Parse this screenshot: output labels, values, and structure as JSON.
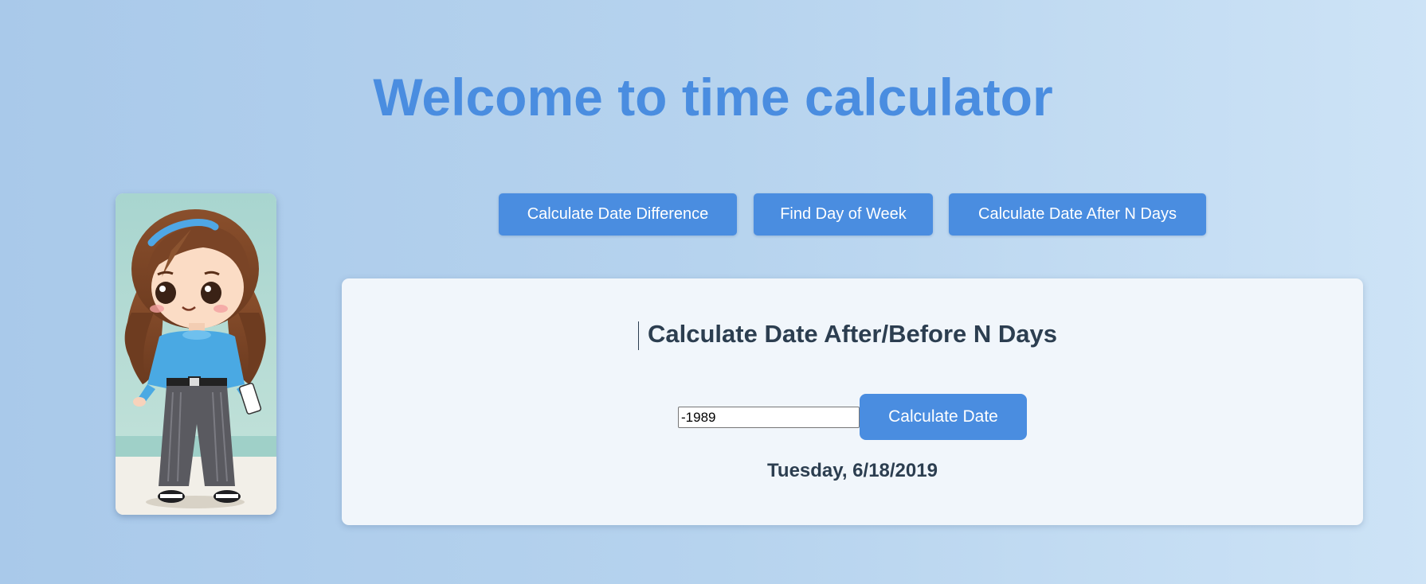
{
  "page": {
    "title": "Welcome to time calculator"
  },
  "nav": {
    "buttons": [
      {
        "label": "Calculate Date Difference"
      },
      {
        "label": "Find Day of Week"
      },
      {
        "label": "Calculate Date After N Days"
      }
    ]
  },
  "panel": {
    "title": "Calculate Date After/Before N Days",
    "days_input_value": "-1989",
    "calculate_button_label": "Calculate Date",
    "result": "Tuesday, 6/18/2019"
  },
  "colors": {
    "accent": "#4a8de0",
    "heading_text": "#2c3e50",
    "panel_background": "#f1f6fb"
  },
  "icons": {
    "avatar": "cartoon-girl-illustration"
  }
}
